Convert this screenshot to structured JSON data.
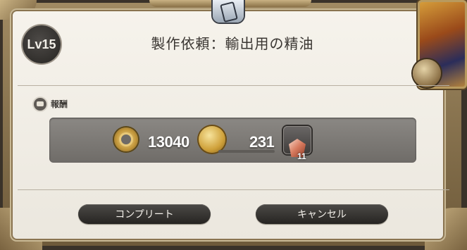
{
  "dialog": {
    "level": "Lv15",
    "title": "製作依頼：輸出用の精油",
    "rewards_label": "報酬",
    "rewards": {
      "gil": "13040",
      "currency": "231",
      "item_quantity": "11"
    },
    "buttons": {
      "complete": "コンプリート",
      "cancel": "キャンセル"
    }
  },
  "icons": [
    "gil-icon",
    "scrip-coin-icon",
    "crystal-item-icon",
    "reward-bag-icon"
  ]
}
